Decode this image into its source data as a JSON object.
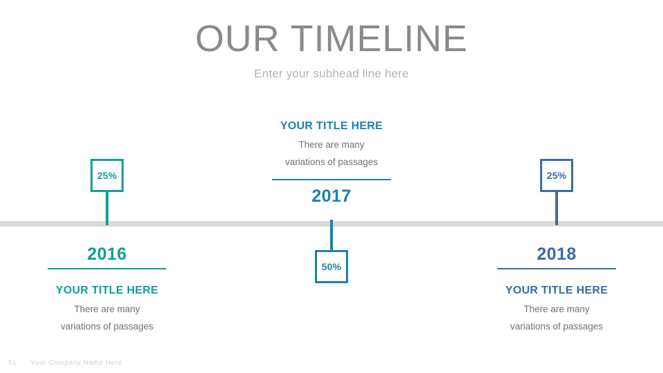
{
  "header": {
    "title": "OUR TIMELINE",
    "subtitle": "Enter your subhead line here"
  },
  "footer": {
    "page_number": "51",
    "company": "Your Company Name Here"
  },
  "colors": {
    "teal": "#0da097",
    "blue": "#1b82ad",
    "navy": "#3a6ba5",
    "bar": "#d9d9d9",
    "title_gray": "#8a8a8a",
    "subtitle_gray": "#b3b3b3",
    "body_gray": "#6e7275"
  },
  "timeline": {
    "milestones": [
      {
        "year": "2016",
        "percent": "25%",
        "title": "YOUR TITLE HERE",
        "body_line1": "There are many",
        "body_line2": "variations of passages",
        "color": "#0da097",
        "position": "below-bar"
      },
      {
        "year": "2017",
        "percent": "50%",
        "title": "YOUR TITLE HERE",
        "body_line1": "There are many",
        "body_line2": "variations of passages",
        "color": "#1b82ad",
        "position": "above-bar"
      },
      {
        "year": "2018",
        "percent": "25%",
        "title": "YOUR TITLE HERE",
        "body_line1": "There are many",
        "body_line2": "variations of passages",
        "color": "#3a6ba5",
        "position": "below-bar"
      }
    ]
  }
}
